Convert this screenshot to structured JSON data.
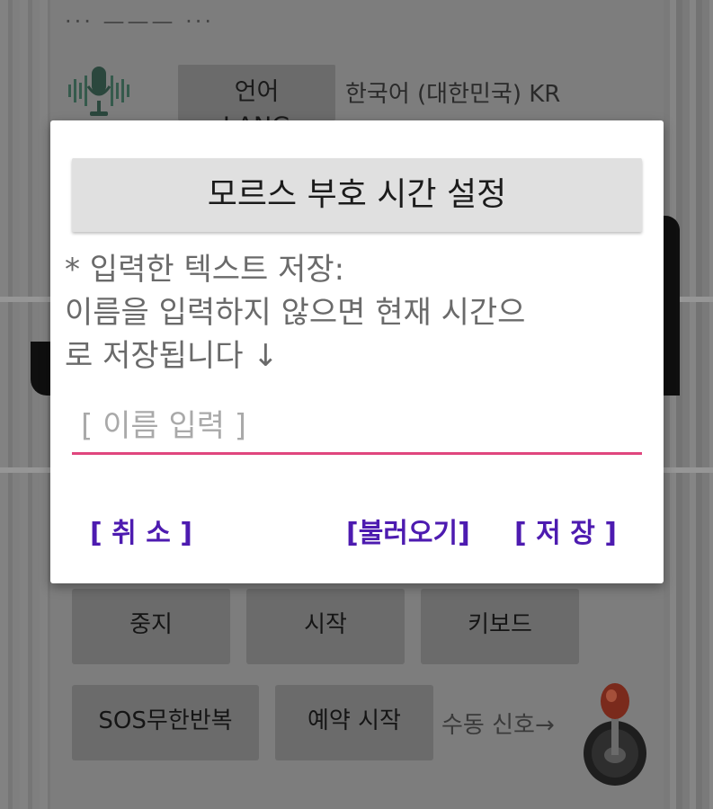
{
  "background_app": {
    "dots": "··· ——— ···",
    "lang_button": "언어\nLANG",
    "lang_value": "한국어 (대한민국) KR",
    "buttons_row1": [
      "중지",
      "시작",
      "키보드"
    ],
    "buttons_row2": [
      "SOS무한반복",
      "예약 시작"
    ],
    "manual_signal_label": "수동 신호→",
    "icons": {
      "mic": "microphone-icon",
      "joystick": "joystick-icon"
    }
  },
  "dialog": {
    "title": "모르스 부호 시간 설정",
    "message_line1": "* 입력한 텍스트 저장:",
    "message_line2": "이름을 입력하지 않으면 현재 시간으",
    "message_line3": "로 저장됩니다 ↓",
    "input": {
      "value": "",
      "placeholder": "[ 이름 입력 ]"
    },
    "buttons": {
      "cancel": "[ 취 소 ]",
      "load": "[불러오기]",
      "save": "[ 저 장 ]"
    },
    "colors": {
      "accent": "#e0467e",
      "button_text": "#4d1bb0"
    }
  }
}
